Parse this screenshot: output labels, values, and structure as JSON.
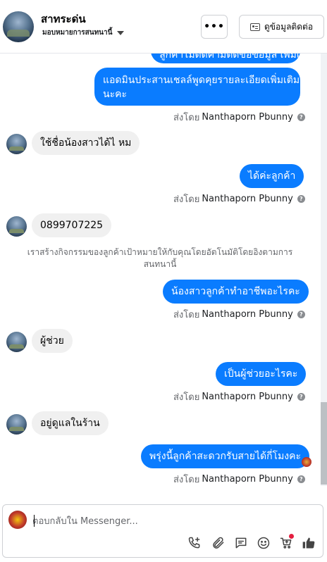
{
  "header": {
    "page_name": "สาทระด่น",
    "assign_label": "มอบหมายการสนทนานี้",
    "more_label": "•••",
    "contact_label": "ดูข้อมูลติดต่อ"
  },
  "messages": {
    "out_cut": "ลูกค้าไม่ตัดคามีตัดขอข้อมูล เพิ่มเติม",
    "out_1_line1": "แอดมินประสานเชลล์พูดคุยรายละเอียดเพิ่มเติม",
    "out_1_line2": "นะคะ",
    "in_1": "ใช้ชื่อน้องสาวได้ไ หม",
    "out_2": "ได้ค่ะลูกค้า",
    "in_2": "0899707225",
    "system_note": "เราสร้างกิจกรรมของลูกค้าเป้าหมายให้กับคุณโดยอัตโนมัติโดยอิงตามการสนทนานี้",
    "out_3": "น้องสาวลูกค้าทำอาชีพอะไรคะ",
    "in_3": "ผู้ช่วย",
    "out_4": "เป็นผู้ช่วยอะไรคะ",
    "in_4": "อยู่ดูแลในร้าน",
    "out_5": "พรุ่งนี้ลูกค้าสะดวกรับสายได้กี่โมงคะ"
  },
  "sent_by": {
    "prefix": "ส่งโดย",
    "sender": "Nanthaporn Pbunny",
    "info_glyph": "?"
  },
  "composer": {
    "placeholder": "ตอบกลับใน Messenger..."
  },
  "icons": [
    "call-add-icon",
    "attachment-icon",
    "saved-reply-icon",
    "emoji-icon",
    "cart-icon",
    "like-icon"
  ],
  "colors": {
    "outgoing": "#0a7cff",
    "incoming": "#f0f0f0",
    "muted": "#65676b",
    "notification": "#e41e3f"
  }
}
